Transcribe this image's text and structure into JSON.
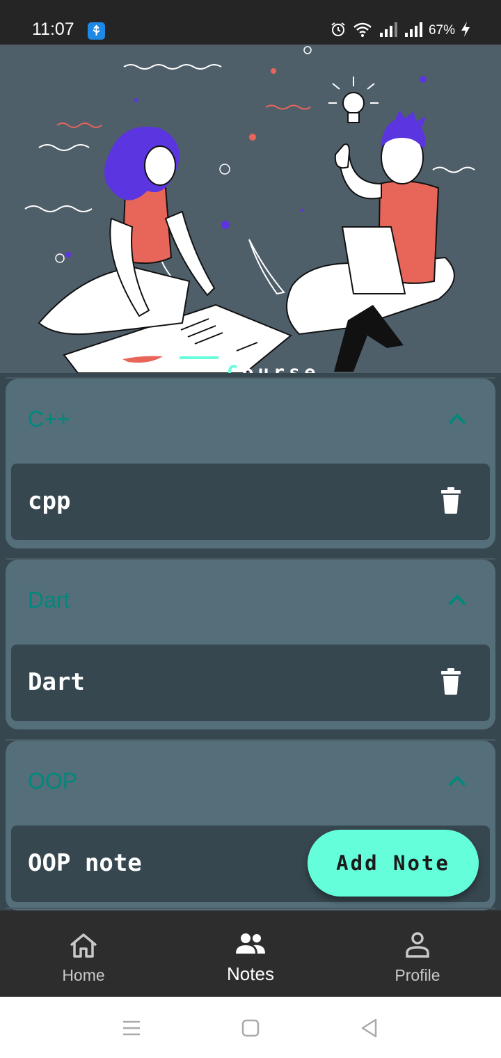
{
  "status_bar": {
    "time": "11:07",
    "battery": "67%",
    "icons": [
      "usb-icon",
      "alarm-icon",
      "wifi-icon",
      "signal-icon",
      "signal-icon",
      "charging-icon"
    ]
  },
  "hero": {
    "title": "Course",
    "illustration": "two-people-studying-illustration"
  },
  "courses": [
    {
      "title": "C++",
      "expanded": true,
      "notes": [
        {
          "title": "cpp"
        }
      ]
    },
    {
      "title": "Dart",
      "expanded": true,
      "notes": [
        {
          "title": "Dart"
        }
      ]
    },
    {
      "title": "OOP",
      "expanded": true,
      "notes": [
        {
          "title": "OOP note"
        }
      ]
    }
  ],
  "fab": {
    "label": "Add Note"
  },
  "bottom_nav": {
    "items": [
      {
        "label": "Home",
        "icon": "home-icon",
        "active": false
      },
      {
        "label": "Notes",
        "icon": "people-icon",
        "active": true
      },
      {
        "label": "Profile",
        "icon": "person-icon",
        "active": false
      }
    ]
  },
  "system_nav": {
    "buttons": [
      "recents-icon",
      "home-square-icon",
      "back-icon"
    ]
  },
  "colors": {
    "accent": "#64ffda",
    "course_title": "#00897b",
    "card": "#546e7a",
    "background": "#37474f",
    "nav_bar": "#2d2d2d"
  }
}
